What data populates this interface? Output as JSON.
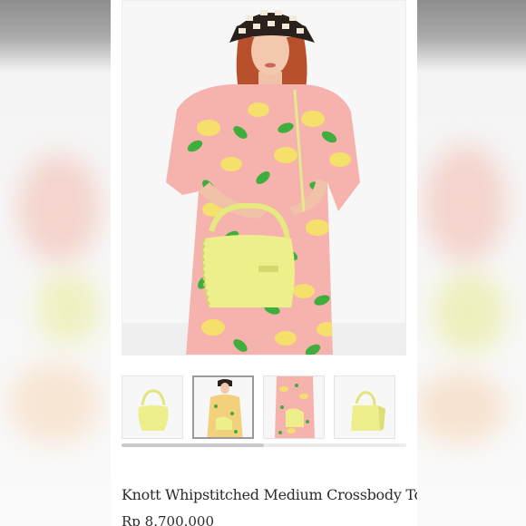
{
  "product": {
    "title": "Knott Whipstitched Medium Crossbody Tote",
    "price": "Rp 8.700.000"
  },
  "gallery": {
    "main_image": "model-holding-yellow-tote",
    "thumbnails": [
      {
        "name": "bag-front"
      },
      {
        "name": "model-front",
        "active": true
      },
      {
        "name": "model-crossbody"
      },
      {
        "name": "bag-side"
      }
    ],
    "scroll_progress": 0.5
  },
  "colors": {
    "bag": "#ecef8a",
    "dress_pink": "#f6b3ad",
    "leaf_green": "#3fae3c",
    "lemon_yellow": "#f4e06a"
  }
}
